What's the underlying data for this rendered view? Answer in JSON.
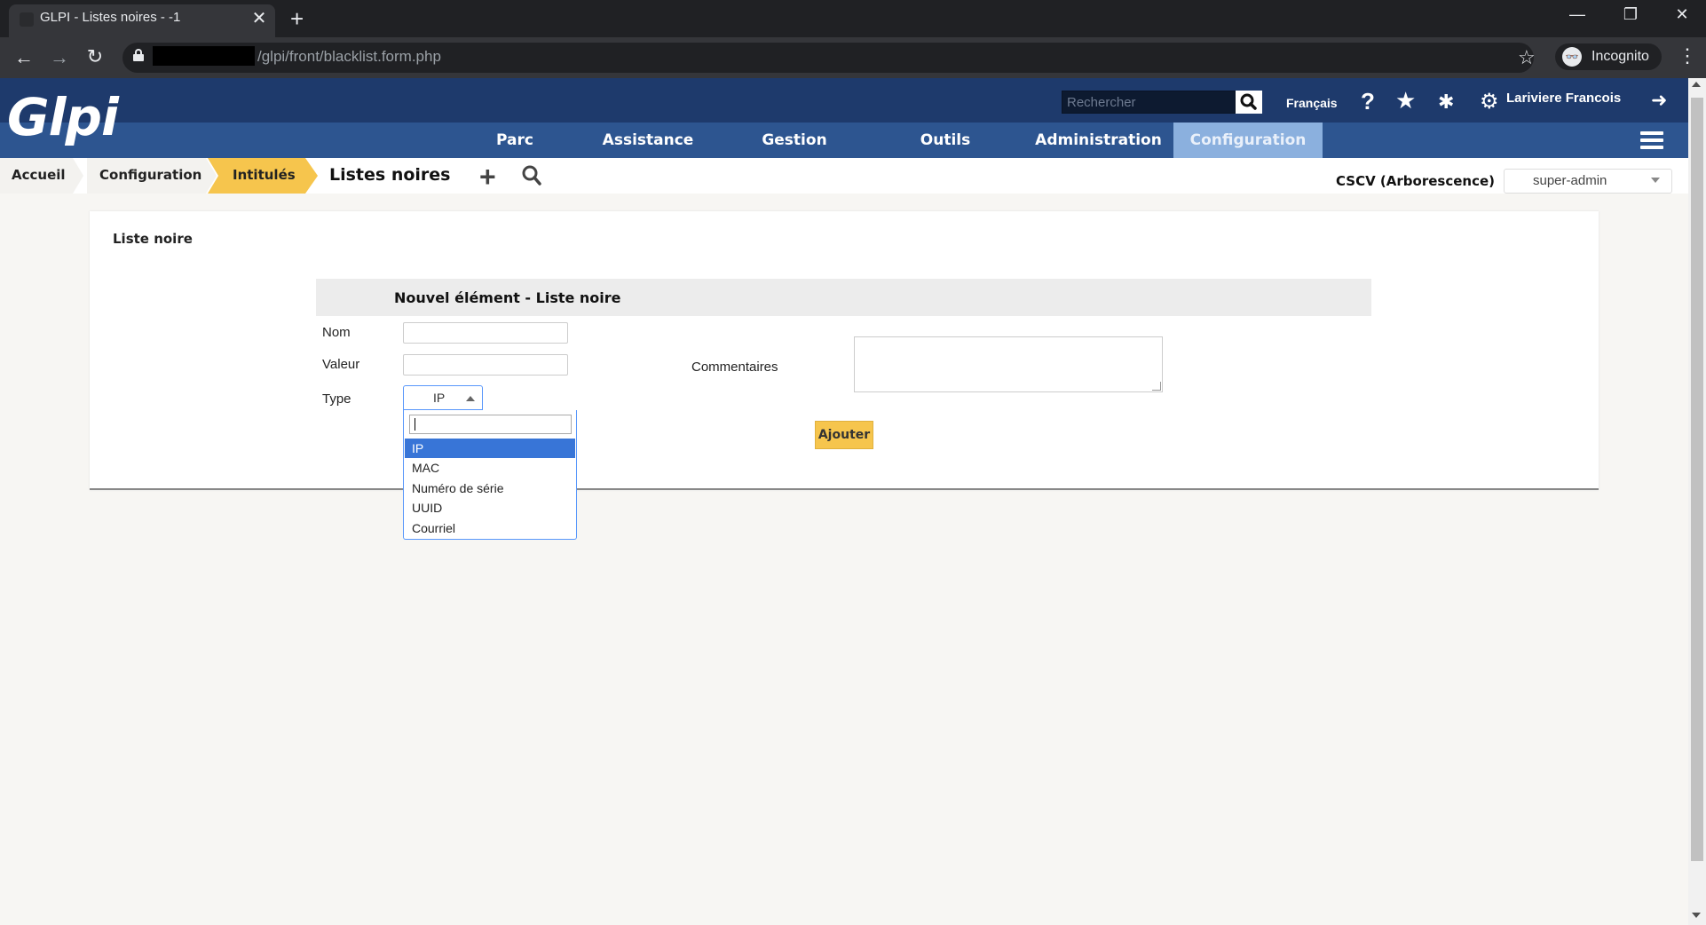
{
  "browser": {
    "tab_title": "GLPI - Listes noires - -1",
    "close_tab": "✕",
    "new_tab": "+",
    "url": "/glpi/front/blacklist.form.php",
    "incognito_label": "Incognito",
    "back": "←",
    "forward": "→",
    "reload": "↻",
    "minimize": "—",
    "maximize": "❐",
    "close": "✕",
    "star": "☆",
    "menu": "⋮",
    "incognito_icon": "👓"
  },
  "header": {
    "logo": "Glpi",
    "search_placeholder": "Rechercher",
    "language": "Français",
    "help": "?",
    "favorite": "★",
    "debug": "✱",
    "settings": "⚙",
    "user_name": "Lariviere Francois",
    "logout": "➜"
  },
  "menu": {
    "items": [
      "Parc",
      "Assistance",
      "Gestion",
      "Outils",
      "Administration",
      "Configuration"
    ],
    "active": "Configuration"
  },
  "breadcrumb": {
    "home": "Accueil",
    "config": "Configuration",
    "dropdowns": "Intitulés",
    "page_title": "Listes noires",
    "add": "+"
  },
  "entity": {
    "label": "CSCV (Arborescence)",
    "profile": "super-admin"
  },
  "panel": {
    "title": "Liste noire"
  },
  "form": {
    "title": "Nouvel élément - Liste noire",
    "name_label": "Nom",
    "name_value": "",
    "value_label": "Valeur",
    "value_value": "",
    "type_label": "Type",
    "type_value": "IP",
    "comments_label": "Commentaires",
    "comments_value": "",
    "submit_label": "Ajouter"
  },
  "type_dropdown": {
    "search_value": "",
    "options": [
      "IP",
      "MAC",
      "Numéro de série",
      "UUID",
      "Courriel"
    ],
    "selected": "IP"
  },
  "colors": {
    "header_bg": "#1e3a6c",
    "nav_bg": "#2d5590",
    "active_menu_bg": "#8bb0de",
    "accent_yellow": "#f6c54d",
    "dropdown_highlight": "#3875d7"
  }
}
